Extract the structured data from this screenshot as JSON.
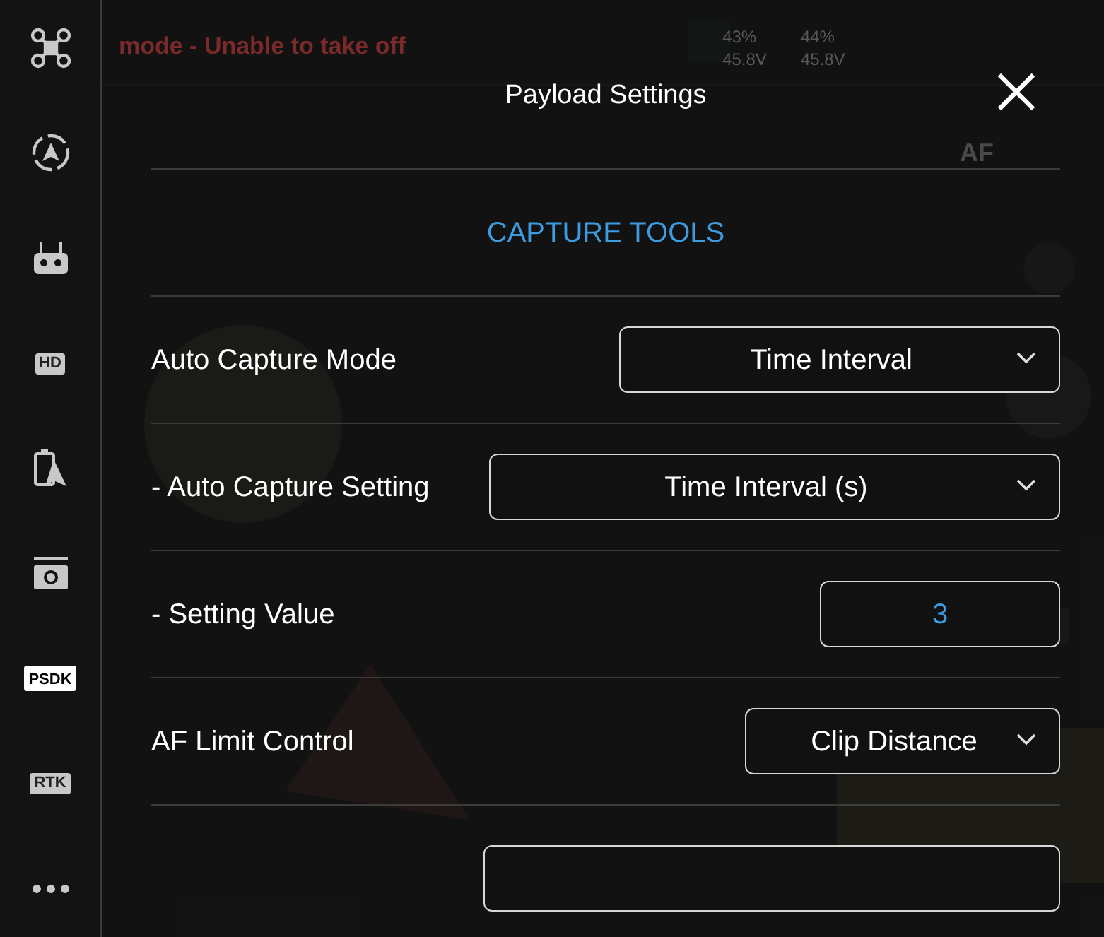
{
  "sidebar": {
    "items": [
      {
        "kind": "drone",
        "selected": false
      },
      {
        "kind": "compass",
        "selected": false
      },
      {
        "kind": "remote",
        "selected": false
      },
      {
        "kind": "badge",
        "label": "HD",
        "selected": false
      },
      {
        "kind": "battery",
        "selected": false
      },
      {
        "kind": "camera",
        "selected": false
      },
      {
        "kind": "badge",
        "label": "PSDK",
        "selected": true
      },
      {
        "kind": "badge",
        "label": "RTK",
        "selected": false
      },
      {
        "kind": "more",
        "selected": false
      }
    ]
  },
  "background_hud": {
    "status": "mode - Unable to take off",
    "batteries": [
      {
        "percent": "43%",
        "voltage": "45.8V"
      },
      {
        "percent": "44%",
        "voltage": "45.8V"
      }
    ],
    "focus_mode": "AF"
  },
  "panel": {
    "title": "Payload Settings",
    "section": "CAPTURE TOOLS",
    "rows": [
      {
        "kind": "dropdown",
        "label": "Auto Capture Mode",
        "value": "Time Interval"
      },
      {
        "kind": "dropdown",
        "label": "- Auto Capture Setting",
        "value": "Time Interval (s)"
      },
      {
        "kind": "input",
        "label": "- Setting Value",
        "value": "3"
      },
      {
        "kind": "dropdown",
        "label": "AF Limit Control",
        "value": "Clip Distance"
      },
      {
        "kind": "partial"
      }
    ]
  }
}
